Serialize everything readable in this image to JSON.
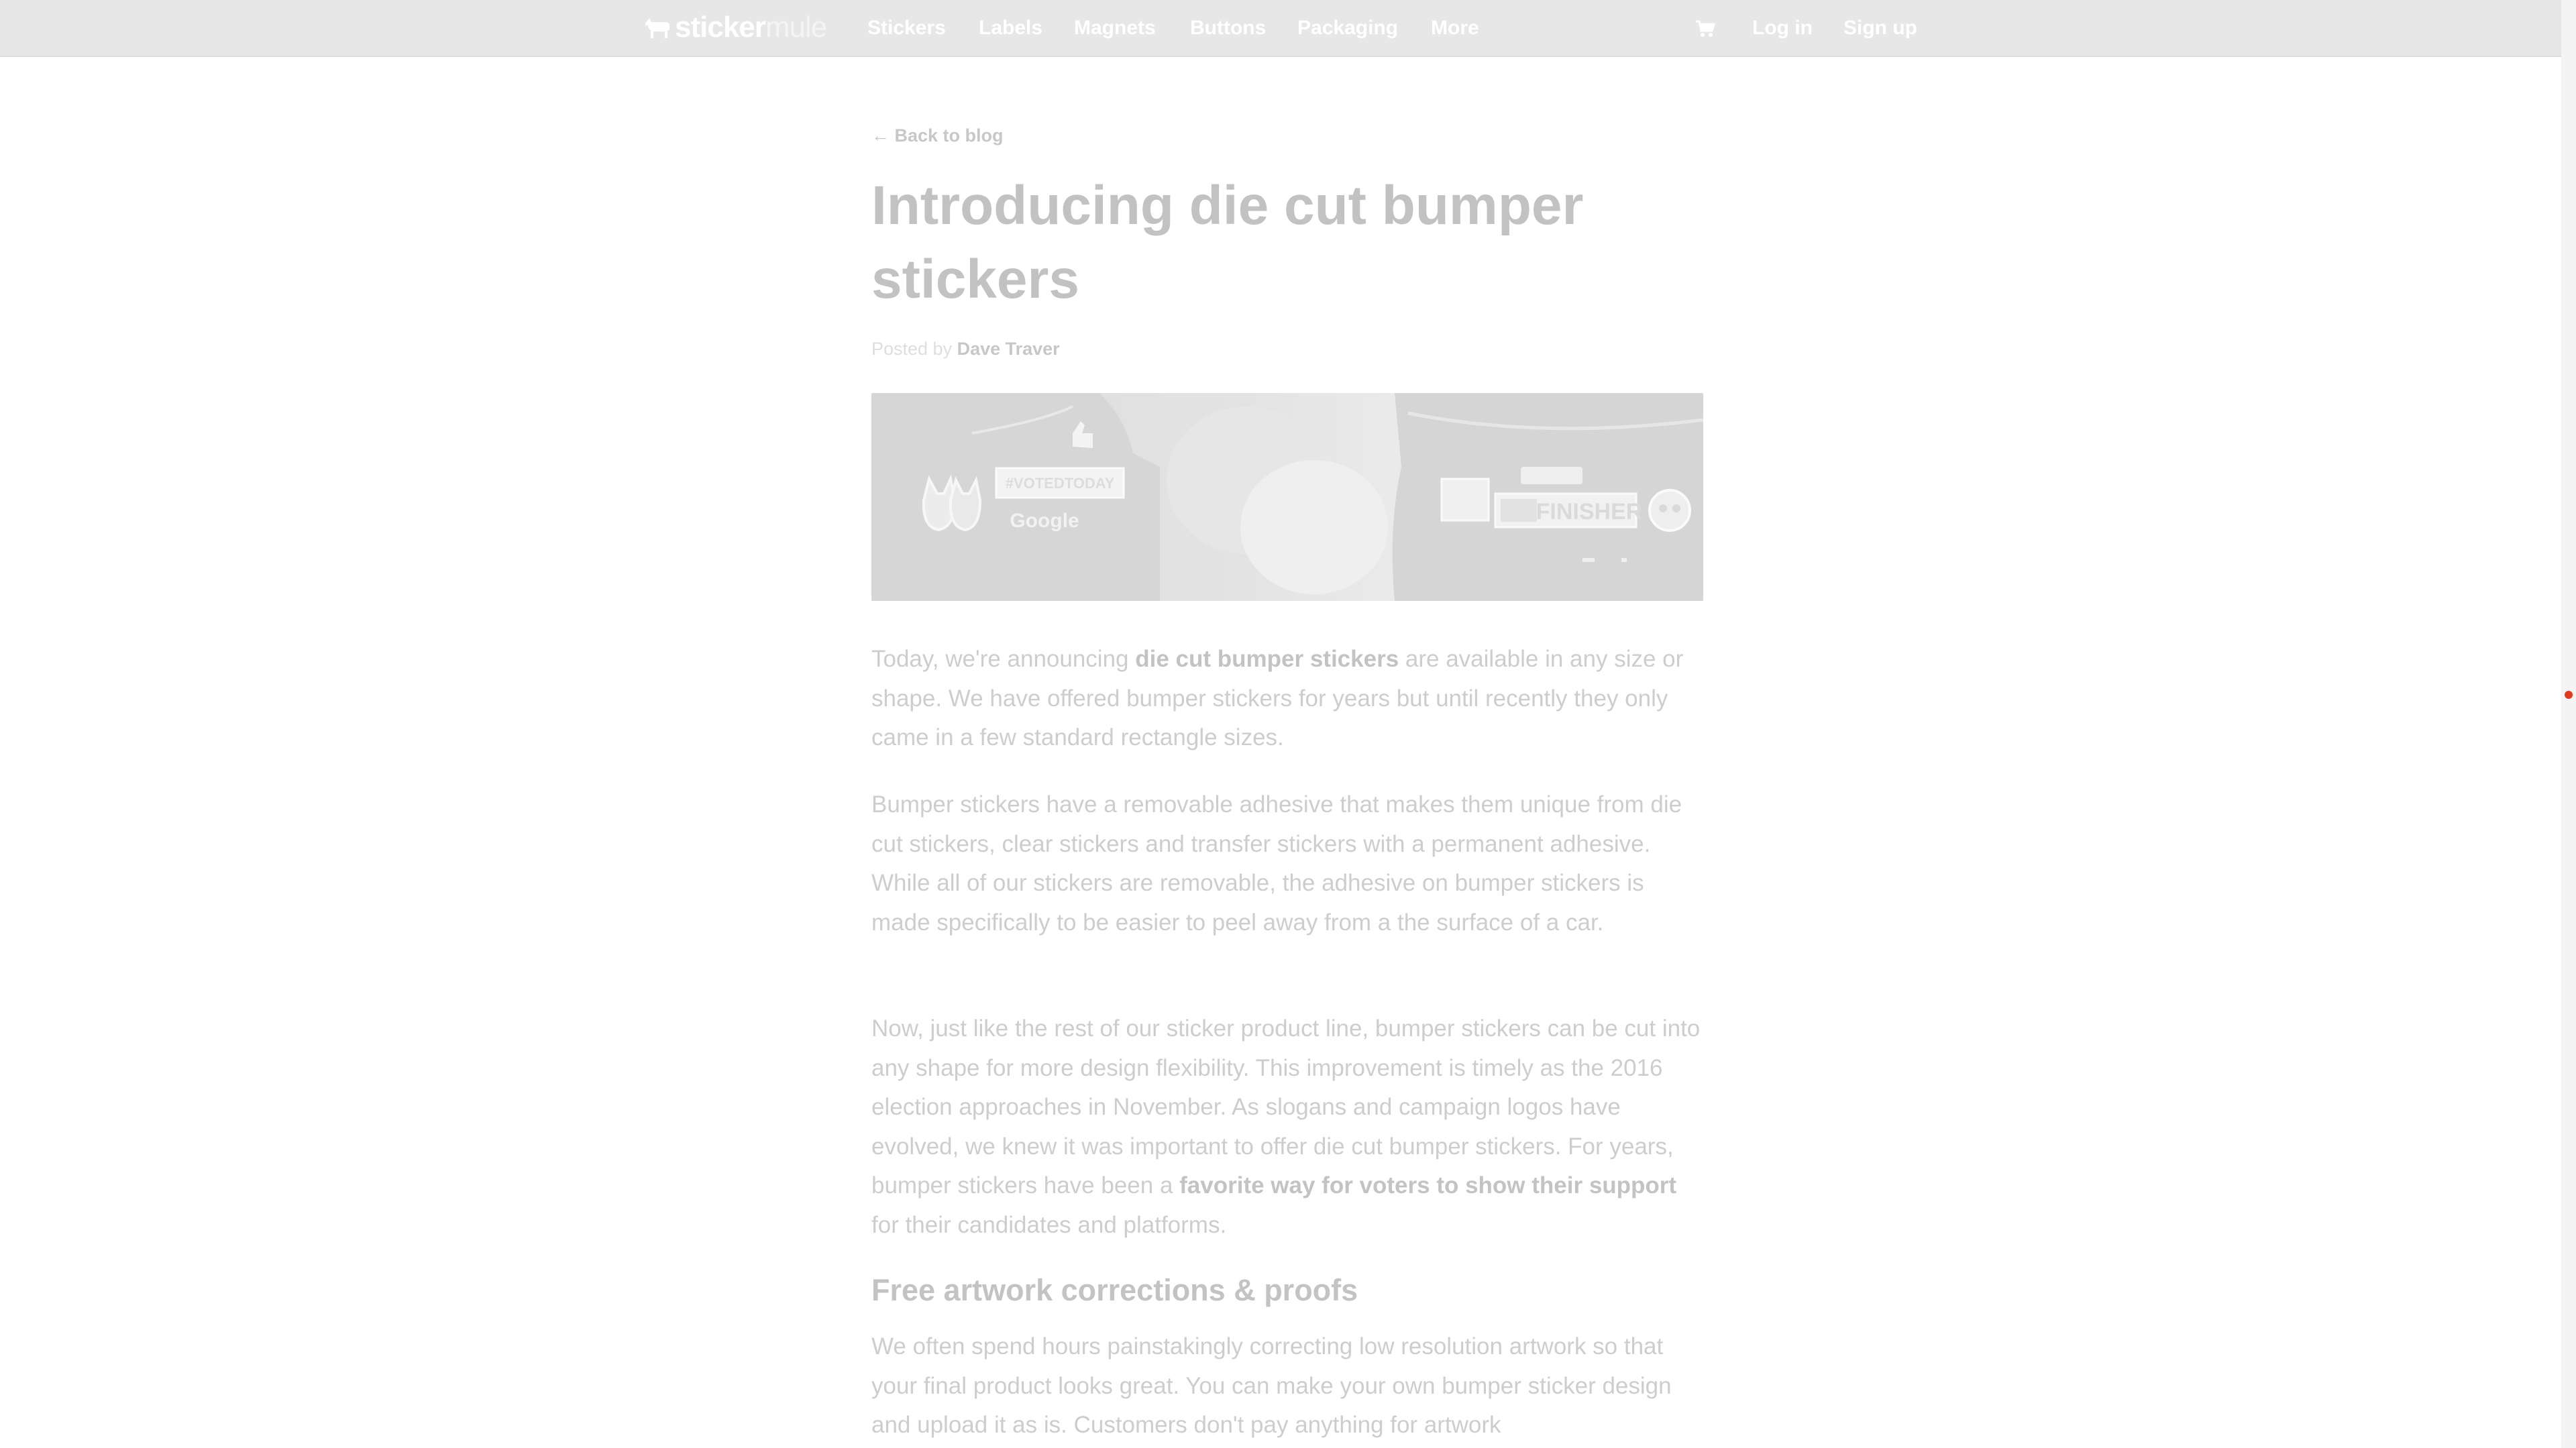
{
  "header": {
    "logo_text_a": "sticker",
    "logo_text_b": "mule",
    "nav": [
      "Stickers",
      "Labels",
      "Magnets",
      "Buttons",
      "Packaging",
      "More"
    ],
    "login": "Log in",
    "signup": "Sign up",
    "cart_icon": "cart-icon"
  },
  "article": {
    "back_link": "← Back to blog",
    "title": "Introducing die cut bumper stickers",
    "byline_prefix": "Posted by ",
    "author": "Dave Traver",
    "hero_image": {
      "sticker_texts": [
        "#VOTEDTODAY",
        "Google",
        "FINISHER"
      ]
    },
    "p1_before": "Today, we're announcing ",
    "p1_link": "die cut bumper stickers",
    "p1_after": " are available in any size or shape. We have offered bumper stickers for years but until recently they only came in a few standard rectangle sizes.",
    "p2": "Bumper stickers have a removable adhesive that makes them unique from die cut stickers, clear stickers and transfer stickers with a permanent adhesive. While all of our stickers are removable, the adhesive on bumper stickers is made specifically to be easier to peel away from a the surface of a car.",
    "p3_before": "Now, just like the rest of our sticker product line, bumper stickers can be cut into any shape for more design flexibility. This improvement is timely as the 2016 election approaches in November. As slogans and campaign logos have evolved, we knew it was important to offer die cut bumper stickers. For years, bumper stickers have been a ",
    "p3_link": "favorite way for voters to show their support",
    "p3_after": " for their candidates and platforms.",
    "subheading": "Free artwork corrections & proofs",
    "p5": "We often spend hours painstakingly correcting low resolution artwork so that your final product looks great. You can make your own bumper sticker design and upload it as is. Customers don't pay anything for artwork"
  },
  "colors": {
    "topbar": "#e7e7e7",
    "nav_text": "#ffffff",
    "body_text": "#cdcdcd",
    "marker": "#e03a1e"
  }
}
